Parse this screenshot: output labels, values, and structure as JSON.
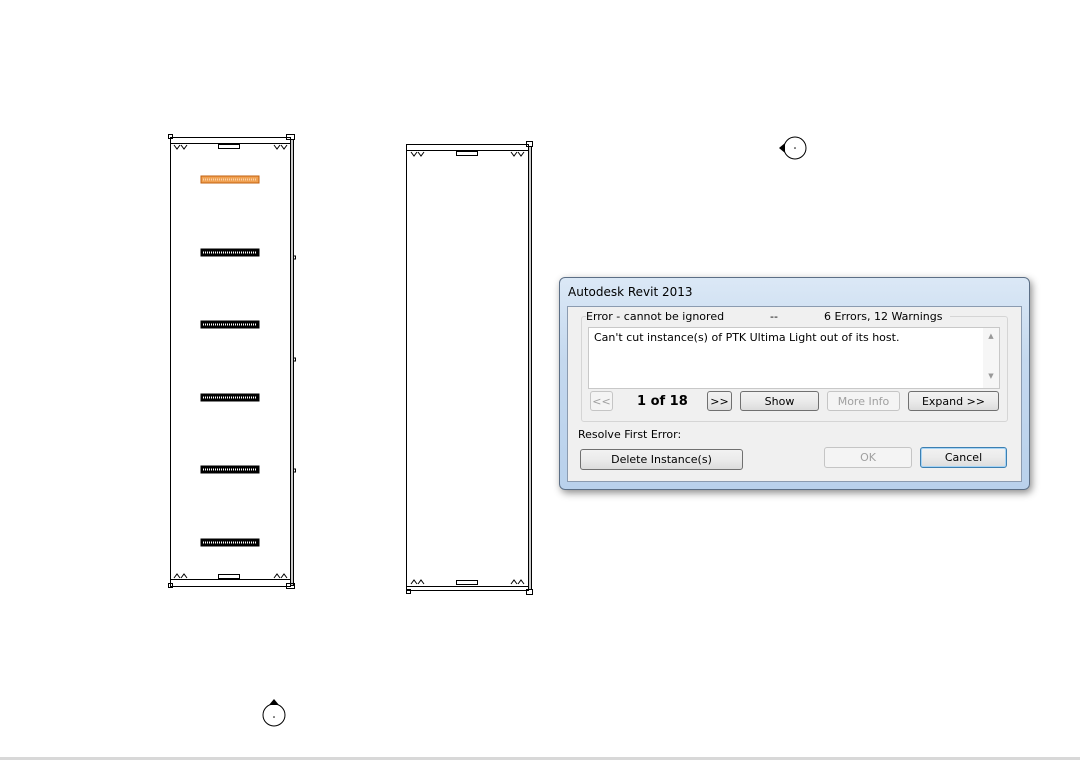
{
  "dialog": {
    "title": "Autodesk Revit 2013",
    "group_severity": "Error - cannot be ignored",
    "group_sep": "--",
    "group_summary": "6 Errors, 12 Warnings",
    "message": "Can't cut instance(s) of PTK Ultima Light out of its host.",
    "scroll_up": "▲",
    "scroll_down": "▼",
    "prev_label": "<<",
    "counter": "1 of 18",
    "next_label": ">>",
    "show_label": "Show",
    "more_info_label": "More Info",
    "expand_label": "Expand >>",
    "resolve_label": "Resolve First Error:",
    "delete_label": "Delete Instance(s)",
    "ok_label": "OK",
    "cancel_label": "Cancel"
  },
  "colors": {
    "highlight_bar": "#f0a050",
    "accent": "#3c7fb1"
  }
}
